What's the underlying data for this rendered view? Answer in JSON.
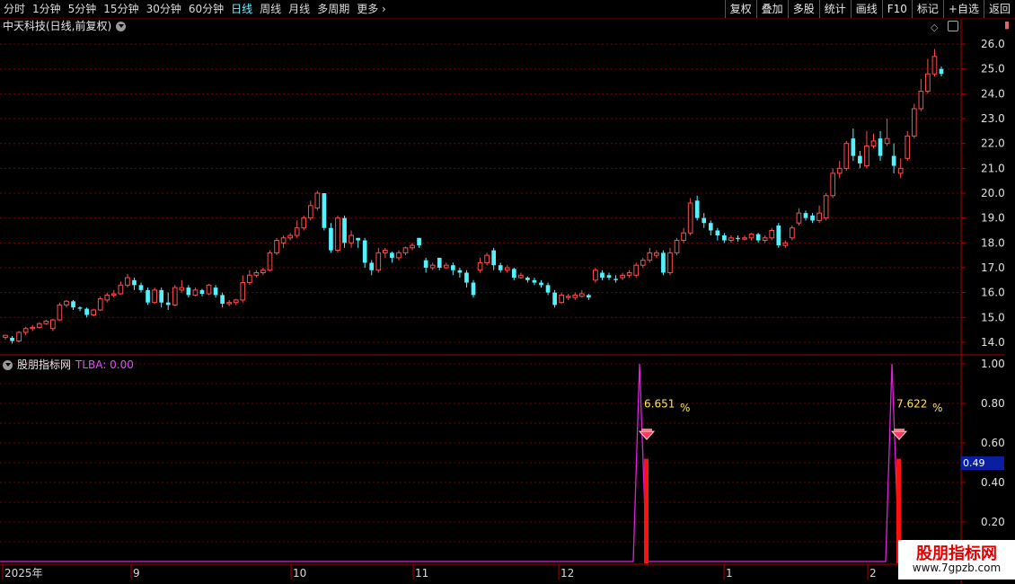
{
  "toolbar": {
    "periods": [
      "分时",
      "1分钟",
      "5分钟",
      "15分钟",
      "30分钟",
      "60分钟",
      "日线",
      "周线",
      "月线",
      "多周期",
      "更多"
    ],
    "active_period": "日线",
    "actions": [
      "复权",
      "叠加",
      "多股",
      "统计",
      "画线",
      "F10",
      "标记",
      "+自选",
      "返回"
    ]
  },
  "symbol_title": "中天科技(日线,前复权)",
  "indicator": {
    "name": "股朋指标网",
    "value_label": "TLBA: 0.00"
  },
  "current_value_box": "0.49",
  "watermark": {
    "line1": "股朋指标网",
    "line2": "www.7gpzb.com"
  },
  "colors": {
    "up": "#ff4d4d",
    "down": "#54f2ff",
    "grid": "#7a0000",
    "axis": "#b00000",
    "indicator": "#e020e0",
    "signal": "#ff1010",
    "label": "#ffe650"
  },
  "chart_data": [
    {
      "type": "candlestick",
      "title": "中天科技(日线,前复权)",
      "y_ticks": [
        26.0,
        25.0,
        24.0,
        23.0,
        22.0,
        21.0,
        20.0,
        19.0,
        18.0,
        17.0,
        16.0,
        15.0,
        14.0
      ],
      "ylim": [
        13.6,
        26.4
      ],
      "x_labels": [
        "2025年",
        "9",
        "10",
        "11",
        "12",
        "1",
        "2"
      ],
      "candles": [
        [
          14.2,
          14.28,
          14.1,
          14.3
        ],
        [
          14.18,
          14.05,
          13.95,
          14.25
        ],
        [
          14.05,
          14.4,
          14.0,
          14.45
        ],
        [
          14.4,
          14.55,
          14.3,
          14.62
        ],
        [
          14.55,
          14.6,
          14.45,
          14.7
        ],
        [
          14.6,
          14.75,
          14.55,
          14.8
        ],
        [
          14.75,
          14.85,
          14.7,
          14.9
        ],
        [
          14.55,
          14.9,
          14.45,
          14.95
        ],
        [
          14.9,
          15.5,
          14.85,
          15.6
        ],
        [
          15.5,
          15.65,
          15.4,
          15.7
        ],
        [
          15.65,
          15.4,
          15.3,
          15.7
        ],
        [
          15.4,
          15.35,
          15.25,
          15.45
        ],
        [
          15.35,
          15.1,
          15.0,
          15.4
        ],
        [
          15.1,
          15.3,
          15.05,
          15.35
        ],
        [
          15.3,
          15.75,
          15.25,
          15.85
        ],
        [
          15.7,
          15.9,
          15.6,
          16.0
        ],
        [
          15.9,
          15.95,
          15.8,
          16.1
        ],
        [
          15.95,
          16.3,
          15.9,
          16.45
        ],
        [
          16.3,
          16.6,
          16.2,
          16.75
        ],
        [
          16.5,
          16.3,
          16.1,
          16.6
        ],
        [
          16.3,
          16.1,
          16.0,
          16.4
        ],
        [
          16.1,
          15.6,
          15.5,
          16.2
        ],
        [
          15.6,
          16.1,
          15.55,
          16.2
        ],
        [
          16.1,
          15.6,
          15.4,
          16.2
        ],
        [
          15.6,
          15.5,
          15.3,
          16.0
        ],
        [
          15.5,
          16.2,
          15.45,
          16.3
        ],
        [
          16.1,
          16.2,
          16.0,
          16.5
        ],
        [
          16.2,
          15.9,
          15.8,
          16.3
        ],
        [
          15.9,
          16.1,
          15.85,
          16.2
        ],
        [
          16.1,
          15.95,
          15.85,
          16.15
        ],
        [
          15.95,
          16.3,
          15.9,
          16.35
        ],
        [
          16.2,
          15.9,
          15.8,
          16.3
        ],
        [
          15.9,
          15.55,
          15.4,
          16.0
        ],
        [
          15.55,
          15.6,
          15.45,
          15.7
        ],
        [
          15.6,
          15.7,
          15.5,
          15.75
        ],
        [
          15.7,
          16.4,
          15.6,
          16.7
        ],
        [
          16.4,
          16.7,
          16.3,
          16.9
        ],
        [
          16.7,
          16.8,
          16.6,
          16.9
        ],
        [
          16.8,
          16.9,
          16.7,
          17.0
        ],
        [
          16.9,
          17.6,
          16.85,
          17.7
        ],
        [
          17.6,
          18.1,
          17.5,
          18.2
        ],
        [
          18.0,
          18.2,
          17.8,
          18.3
        ],
        [
          18.2,
          18.3,
          18.1,
          18.4
        ],
        [
          18.3,
          18.6,
          18.2,
          18.9
        ],
        [
          18.6,
          19.0,
          18.5,
          19.1
        ],
        [
          19.0,
          19.5,
          18.9,
          19.7
        ],
        [
          19.4,
          20.0,
          19.3,
          20.1
        ],
        [
          20.0,
          18.6,
          18.5,
          20.0
        ],
        [
          18.6,
          17.7,
          17.6,
          18.8
        ],
        [
          17.7,
          19.0,
          17.6,
          19.1
        ],
        [
          19.0,
          18.0,
          17.8,
          19.1
        ],
        [
          18.0,
          18.3,
          17.8,
          18.5
        ],
        [
          18.2,
          18.1,
          17.8,
          18.2
        ],
        [
          18.1,
          17.2,
          17.0,
          18.2
        ],
        [
          17.2,
          16.9,
          16.7,
          17.3
        ],
        [
          16.9,
          17.6,
          16.8,
          17.8
        ],
        [
          17.6,
          17.7,
          17.4,
          17.8
        ],
        [
          17.6,
          17.4,
          17.2,
          17.65
        ],
        [
          17.4,
          17.6,
          17.3,
          17.7
        ],
        [
          17.6,
          17.8,
          17.5,
          17.85
        ],
        [
          17.8,
          17.9,
          17.7,
          18.0
        ],
        [
          18.2,
          17.9,
          17.8,
          18.2
        ],
        [
          17.3,
          17.0,
          16.8,
          17.4
        ],
        [
          17.0,
          17.1,
          16.9,
          17.2
        ],
        [
          17.4,
          17.0,
          16.9,
          17.4
        ],
        [
          17.0,
          17.1,
          16.95,
          17.2
        ],
        [
          17.1,
          16.9,
          16.7,
          17.2
        ],
        [
          16.9,
          16.8,
          16.6,
          17.0
        ],
        [
          16.8,
          16.4,
          16.2,
          16.9
        ],
        [
          16.4,
          15.9,
          15.8,
          16.5
        ],
        [
          16.9,
          17.2,
          16.8,
          17.4
        ],
        [
          17.2,
          17.5,
          17.1,
          17.6
        ],
        [
          17.7,
          17.1,
          16.9,
          17.8
        ],
        [
          17.1,
          16.9,
          16.8,
          17.2
        ],
        [
          16.9,
          17.0,
          16.8,
          17.1
        ],
        [
          16.95,
          16.6,
          16.5,
          17.0
        ],
        [
          16.6,
          16.7,
          16.55,
          16.8
        ],
        [
          16.6,
          16.5,
          16.4,
          16.65
        ],
        [
          16.5,
          16.4,
          16.3,
          16.6
        ],
        [
          16.4,
          16.3,
          16.2,
          16.5
        ],
        [
          16.3,
          16.0,
          15.9,
          16.4
        ],
        [
          16.0,
          15.5,
          15.4,
          16.1
        ],
        [
          15.6,
          15.9,
          15.55,
          16.0
        ],
        [
          15.8,
          15.85,
          15.7,
          15.95
        ],
        [
          15.8,
          15.9,
          15.7,
          16.0
        ],
        [
          15.85,
          15.95,
          15.8,
          16.1
        ],
        [
          15.9,
          15.8,
          15.7,
          15.95
        ],
        [
          16.5,
          16.9,
          16.4,
          17.0
        ],
        [
          16.8,
          16.6,
          16.5,
          16.9
        ],
        [
          16.7,
          16.6,
          16.5,
          16.8
        ],
        [
          16.55,
          16.5,
          16.4,
          16.7
        ],
        [
          16.6,
          16.7,
          16.5,
          16.8
        ],
        [
          16.7,
          16.8,
          16.6,
          16.9
        ],
        [
          16.7,
          17.1,
          16.6,
          17.2
        ],
        [
          17.1,
          17.3,
          17.0,
          17.4
        ],
        [
          17.3,
          17.6,
          17.2,
          17.8
        ],
        [
          17.5,
          17.6,
          17.4,
          17.7
        ],
        [
          17.6,
          16.8,
          16.7,
          17.7
        ],
        [
          16.8,
          17.6,
          16.7,
          17.8
        ],
        [
          17.6,
          18.1,
          17.5,
          18.2
        ],
        [
          18.1,
          18.4,
          18.0,
          18.6
        ],
        [
          18.4,
          19.6,
          18.3,
          19.8
        ],
        [
          19.7,
          19.0,
          18.9,
          19.9
        ],
        [
          19.0,
          18.8,
          18.6,
          19.2
        ],
        [
          18.8,
          18.5,
          18.3,
          18.9
        ],
        [
          18.5,
          18.3,
          18.1,
          18.6
        ],
        [
          18.3,
          18.1,
          18.0,
          18.4
        ],
        [
          18.1,
          18.2,
          18.0,
          18.3
        ],
        [
          18.2,
          18.15,
          18.05,
          18.3
        ],
        [
          18.15,
          18.2,
          18.1,
          18.3
        ],
        [
          18.2,
          18.35,
          18.1,
          18.4
        ],
        [
          18.35,
          18.1,
          18.0,
          18.4
        ],
        [
          18.1,
          18.2,
          18.0,
          18.3
        ],
        [
          18.2,
          18.5,
          18.1,
          18.6
        ],
        [
          18.7,
          17.9,
          17.8,
          18.8
        ],
        [
          17.9,
          18.0,
          17.8,
          18.1
        ],
        [
          18.2,
          18.6,
          18.1,
          18.7
        ],
        [
          18.8,
          19.2,
          18.7,
          19.4
        ],
        [
          19.2,
          19.0,
          18.9,
          19.3
        ],
        [
          19.1,
          18.9,
          18.8,
          19.2
        ],
        [
          18.9,
          19.2,
          18.8,
          19.5
        ],
        [
          19.0,
          19.9,
          18.9,
          20.0
        ],
        [
          19.9,
          20.8,
          19.8,
          21.0
        ],
        [
          20.8,
          21.0,
          20.6,
          21.3
        ],
        [
          21.0,
          22.0,
          20.9,
          22.1
        ],
        [
          22.2,
          21.5,
          21.3,
          22.6
        ],
        [
          21.5,
          21.2,
          21.0,
          21.7
        ],
        [
          21.1,
          21.9,
          21.0,
          22.5
        ],
        [
          21.9,
          22.1,
          21.8,
          22.4
        ],
        [
          22.2,
          21.5,
          21.3,
          22.5
        ],
        [
          22.0,
          22.2,
          21.9,
          23.0
        ],
        [
          21.5,
          21.1,
          20.8,
          22.0
        ],
        [
          20.8,
          21.0,
          20.6,
          21.4
        ],
        [
          21.4,
          22.3,
          21.3,
          22.5
        ],
        [
          22.3,
          23.4,
          22.2,
          23.6
        ],
        [
          23.4,
          24.1,
          23.3,
          24.6
        ],
        [
          24.1,
          24.8,
          24.0,
          25.4
        ],
        [
          24.8,
          25.5,
          24.7,
          25.8
        ],
        [
          25.0,
          24.8,
          24.7,
          25.1
        ]
      ]
    },
    {
      "type": "line",
      "title": "TLBA",
      "y_ticks": [
        1.0,
        0.8,
        0.6,
        0.4,
        0.2
      ],
      "ylim": [
        0.0,
        1.0
      ],
      "peaks": [
        {
          "label": "6.651",
          "unit": "%"
        },
        {
          "label": "7.622",
          "unit": "%"
        }
      ]
    }
  ]
}
